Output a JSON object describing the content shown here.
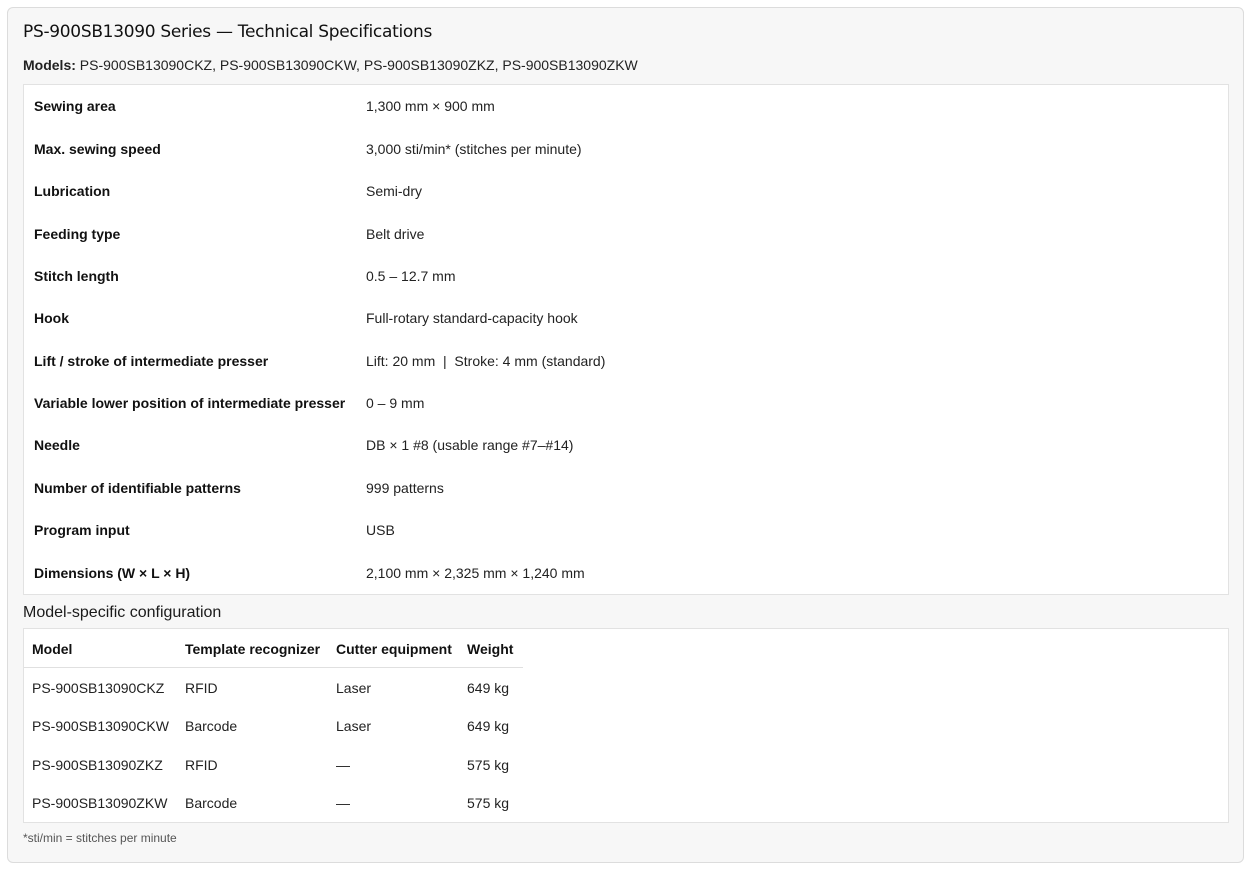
{
  "title": "PS-900SB13090 Series — Technical Specifications",
  "models": {
    "label": "Models:",
    "list": "PS-900SB13090CKZ, PS-900SB13090CKW, PS-900SB13090ZKZ, PS-900SB13090ZKW"
  },
  "specs": [
    {
      "label": "Sewing area",
      "value": "1,300 mm × 900 mm"
    },
    {
      "label": "Max. sewing speed",
      "value": "3,000 sti/min* (stitches per minute)"
    },
    {
      "label": "Lubrication",
      "value": "Semi-dry"
    },
    {
      "label": "Feeding type",
      "value": "Belt drive"
    },
    {
      "label": "Stitch length",
      "value": "0.5 – 12.7 mm"
    },
    {
      "label": "Hook",
      "value": "Full-rotary standard-capacity hook"
    },
    {
      "label": "Lift / stroke of intermediate presser",
      "value": "Lift: 20 mm  |  Stroke: 4 mm (standard)"
    },
    {
      "label": "Variable lower position of intermediate presser",
      "value": "0 – 9 mm"
    },
    {
      "label": "Needle",
      "value": "DB × 1 #8 (usable range #7–#14)"
    },
    {
      "label": "Number of identifiable patterns",
      "value": "999 patterns"
    },
    {
      "label": "Program input",
      "value": "USB"
    },
    {
      "label": "Dimensions (W × L × H)",
      "value": "2,100 mm × 2,325 mm × 1,240 mm"
    }
  ],
  "config": {
    "title": "Model-specific configuration",
    "headers": [
      "Model",
      "Template recognizer",
      "Cutter equipment",
      "Weight"
    ],
    "rows": [
      [
        "PS-900SB13090CKZ",
        "RFID",
        "Laser",
        "649 kg"
      ],
      [
        "PS-900SB13090CKW",
        "Barcode",
        "Laser",
        "649 kg"
      ],
      [
        "PS-900SB13090ZKZ",
        "RFID",
        "—",
        "575 kg"
      ],
      [
        "PS-900SB13090ZKW",
        "Barcode",
        "—",
        "575 kg"
      ]
    ]
  },
  "footnote": "*sti/min = stitches per minute"
}
